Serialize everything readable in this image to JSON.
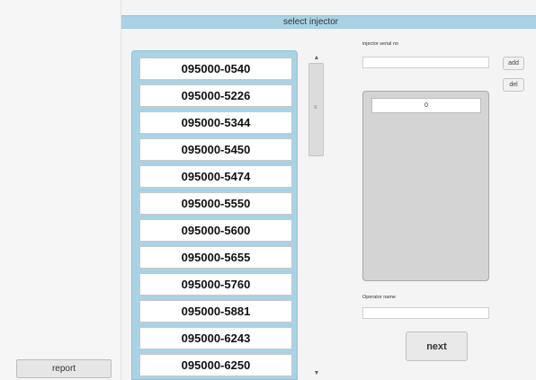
{
  "left": {
    "report_label": "report"
  },
  "header": {
    "title": "select injector"
  },
  "injector_list": {
    "items": [
      "095000-0540",
      "095000-5226",
      "095000-5344",
      "095000-5450",
      "095000-5474",
      "095000-5550",
      "095000-5600",
      "095000-5655",
      "095000-5760",
      "095000-5881",
      "095000-6243",
      "095000-6250"
    ]
  },
  "scrollbar": {
    "up": "▲",
    "grip": "≡",
    "down": "▼"
  },
  "serial": {
    "label": "injector serial no",
    "value": "",
    "add_label": "add",
    "del_label": "del"
  },
  "selected": {
    "count": "0"
  },
  "operator": {
    "label": "Operator name",
    "value": ""
  },
  "next_label": "next"
}
